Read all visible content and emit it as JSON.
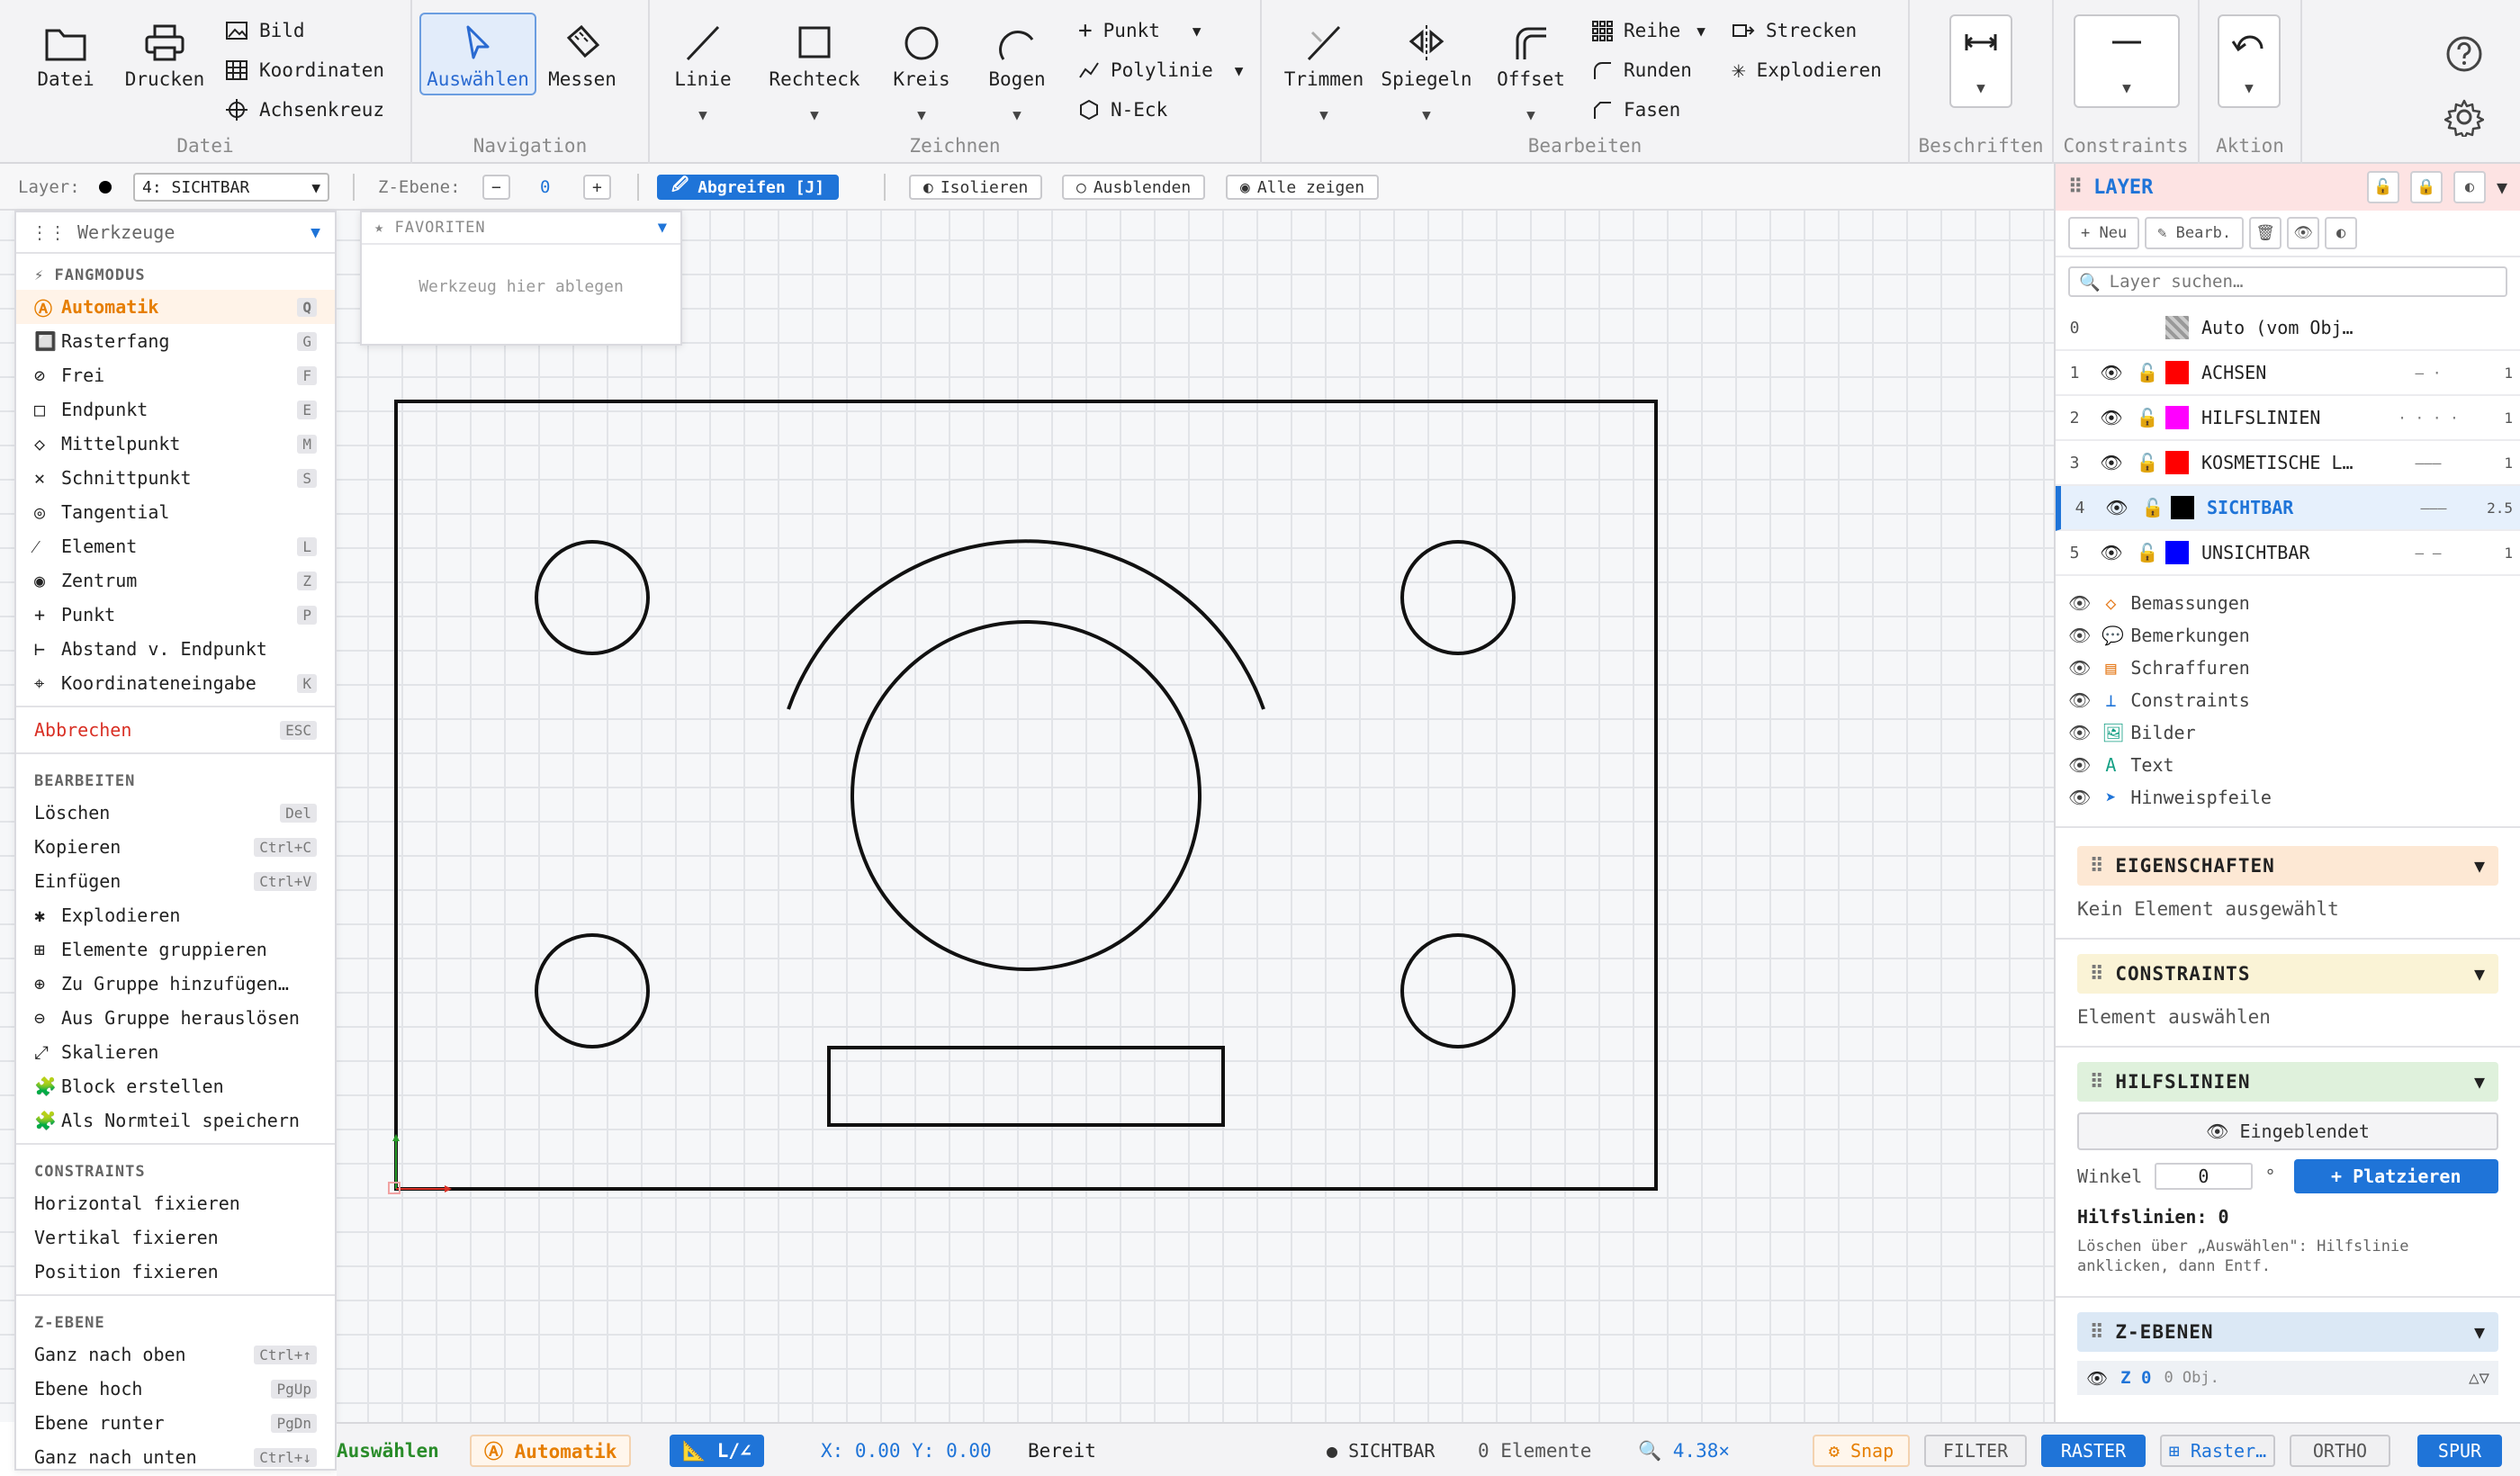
{
  "ribbon": {
    "datei": {
      "title": "Datei",
      "datei_label": "Datei",
      "drucken_label": "Drucken",
      "bild_label": "Bild",
      "koordinaten_label": "Koordinaten",
      "achsenkreuz_label": "Achsenkreuz"
    },
    "navigation": {
      "title": "Navigation",
      "auswaehlen_label": "Auswählen",
      "messen_label": "Messen"
    },
    "zeichnen": {
      "title": "Zeichnen",
      "linie_label": "Linie",
      "rechteck_label": "Rechteck",
      "kreis_label": "Kreis",
      "bogen_label": "Bogen",
      "punkt_label": "Punkt",
      "polylinie_label": "Polylinie",
      "neck_label": "N-Eck"
    },
    "bearbeiten": {
      "title": "Bearbeiten",
      "trimmen_label": "Trimmen",
      "spiegeln_label": "Spiegeln",
      "offset_label": "Offset",
      "reihe_label": "Reihe",
      "runden_label": "Runden",
      "fasen_label": "Fasen",
      "strecken_label": "Strecken",
      "explodieren_label": "Explodieren"
    },
    "beschriften": {
      "title": "Beschriften"
    },
    "constraints": {
      "title": "Constraints"
    },
    "aktion": {
      "title": "Aktion"
    }
  },
  "bar2": {
    "layer_label": "Layer:",
    "layer_value": "4: SICHTBAR",
    "zebene_label": "Z-Ebene:",
    "zebene_minus": "−",
    "zebene_value": "0",
    "zebene_plus": "+",
    "abgreifen_label": "Abgreifen [J]",
    "isolieren_label": "Isolieren",
    "ausblenden_label": "Ausblenden",
    "alle_zeigen_label": "Alle zeigen"
  },
  "tools": {
    "header": "Werkzeuge",
    "fang_title": "⚡ FANGMODUS",
    "fang_items": [
      {
        "icon": "Ⓐ",
        "label": "Automatik",
        "key": "Q"
      },
      {
        "icon": "🔲",
        "label": "Rasterfang",
        "key": "G"
      },
      {
        "icon": "⊘",
        "label": "Frei",
        "key": "F"
      },
      {
        "icon": "□",
        "label": "Endpunkt",
        "key": "E"
      },
      {
        "icon": "◇",
        "label": "Mittelpunkt",
        "key": "M"
      },
      {
        "icon": "✕",
        "label": "Schnittpunkt",
        "key": "S"
      },
      {
        "icon": "◎",
        "label": "Tangential",
        "key": ""
      },
      {
        "icon": "⁄",
        "label": "Element",
        "key": "L"
      },
      {
        "icon": "◉",
        "label": "Zentrum",
        "key": "Z"
      },
      {
        "icon": "+",
        "label": "Punkt",
        "key": "P"
      },
      {
        "icon": "⊢",
        "label": "Abstand v. Endpunkt",
        "key": ""
      },
      {
        "icon": "⌖",
        "label": "Koordinateneingabe",
        "key": "K"
      }
    ],
    "abbrechen_label": "Abbrechen",
    "abbrechen_key": "ESC",
    "bearb_title": "BEARBEITEN",
    "bearb_items": [
      {
        "icon": "",
        "label": "Löschen",
        "key": "Del"
      },
      {
        "icon": "",
        "label": "Kopieren",
        "key": "Ctrl+C"
      },
      {
        "icon": "",
        "label": "Einfügen",
        "key": "Ctrl+V"
      },
      {
        "icon": "✱",
        "label": "Explodieren",
        "key": ""
      },
      {
        "icon": "⊞",
        "label": "Elemente gruppieren",
        "key": ""
      },
      {
        "icon": "⊕",
        "label": "Zu Gruppe hinzufügen…",
        "key": ""
      },
      {
        "icon": "⊖",
        "label": "Aus Gruppe herauslösen",
        "key": ""
      },
      {
        "icon": "⤢",
        "label": "Skalieren",
        "key": ""
      },
      {
        "icon": "🧩",
        "label": "Block erstellen",
        "key": ""
      },
      {
        "icon": "🧩",
        "label": "Als Normteil speichern",
        "key": ""
      }
    ],
    "constr_title": "CONSTRAINTS",
    "constr_items": [
      {
        "label": "Horizontal fixieren"
      },
      {
        "label": "Vertikal fixieren"
      },
      {
        "label": "Position fixieren"
      }
    ],
    "zebene_title": "Z-EBENE",
    "zebene_items": [
      {
        "label": "Ganz nach oben",
        "key": "Ctrl+↑"
      },
      {
        "label": "Ebene hoch",
        "key": "PgUp"
      },
      {
        "label": "Ebene runter",
        "key": "PgDn"
      },
      {
        "label": "Ganz nach unten",
        "key": "Ctrl+↓"
      }
    ]
  },
  "favoriten": {
    "title": "★ FAVORITEN",
    "placeholder": "Werkzeug hier ablegen"
  },
  "layer_panel": {
    "title": "LAYER",
    "neu_label": "+ Neu",
    "bearb_label": "✎ Bearb.",
    "search_placeholder": "Layer suchen…",
    "layers": [
      {
        "num": "0",
        "name": "Auto (vom Obj…",
        "color": "#aaaaaa",
        "line": "",
        "width": ""
      },
      {
        "num": "1",
        "name": "ACHSEN",
        "color": "#ff0000",
        "line": "— ·",
        "width": "1"
      },
      {
        "num": "2",
        "name": "HILFSLINIEN",
        "color": "#ff00ff",
        "line": "· · · ·",
        "width": "1"
      },
      {
        "num": "3",
        "name": "KOSMETISCHE L…",
        "color": "#ff0000",
        "line": "———",
        "width": "1"
      },
      {
        "num": "4",
        "name": "SICHTBAR",
        "color": "#000000",
        "line": "———",
        "width": "2.5"
      },
      {
        "num": "5",
        "name": "UNSICHTBAR",
        "color": "#0000ff",
        "line": "— —",
        "width": "1"
      }
    ],
    "visibility": [
      {
        "icon": "◇",
        "label": "Bemassungen",
        "color": "#e67e22"
      },
      {
        "icon": "💬",
        "label": "Bemerkungen",
        "color": "#666666"
      },
      {
        "icon": "▤",
        "label": "Schraffuren",
        "color": "#e67e22"
      },
      {
        "icon": "⊥",
        "label": "Constraints",
        "color": "#1f74d8"
      },
      {
        "icon": "🖼",
        "label": "Bilder",
        "color": "#16a085"
      },
      {
        "icon": "A",
        "label": "Text",
        "color": "#16a085"
      },
      {
        "icon": "➤",
        "label": "Hinweispfeile",
        "color": "#1f74d8"
      }
    ]
  },
  "eigenschaften": {
    "title": "EIGENSCHAFTEN",
    "body": "Kein Element ausgewählt"
  },
  "constraints_panel": {
    "title": "CONSTRAINTS",
    "body": "Element auswählen"
  },
  "hilfslinien": {
    "title": "HILFSLINIEN",
    "eingeblendet_label": "👁 Eingeblendet",
    "winkel_label": "Winkel",
    "winkel_value": "0",
    "grad": "°",
    "platzieren_label": "+ Platzieren",
    "count_label": "Hilfslinien:",
    "count_value": "0",
    "hint": "Löschen über „Auswählen\": Hilfslinie anklicken, dann Entf."
  },
  "zebenen": {
    "title": "Z-EBENEN",
    "item_label": "Z 0",
    "item_count": "0 Obj.",
    "item_arrows": "△▽"
  },
  "status": {
    "tool": "Auswählen",
    "snap_mode": "Ⓐ Automatik",
    "ortho_mode": "📐 L/∠",
    "coords": "X: 0.00 Y: 0.00",
    "state": "Bereit",
    "layer": "● SICHTBAR",
    "elements": "0 Elemente",
    "zoom": "🔍 4.38×",
    "snap_btn": "⚙ Snap",
    "filter_btn": "FILTER",
    "raster_btn": "RASTER",
    "raster_opt_btn": "⊞ Raster…",
    "ortho_btn": "ORTHO",
    "spur_btn": "SPUR"
  },
  "colors": {
    "accent": "#1f74d8",
    "snap": "#e67e00",
    "layer_header_bg": "#fde3e3",
    "eigenschaften_bg": "#fde8d4",
    "constraints_bg": "#faf3d6",
    "hilfslinien_bg": "#dff1dc",
    "zebenen_bg": "#dbe8f5"
  }
}
